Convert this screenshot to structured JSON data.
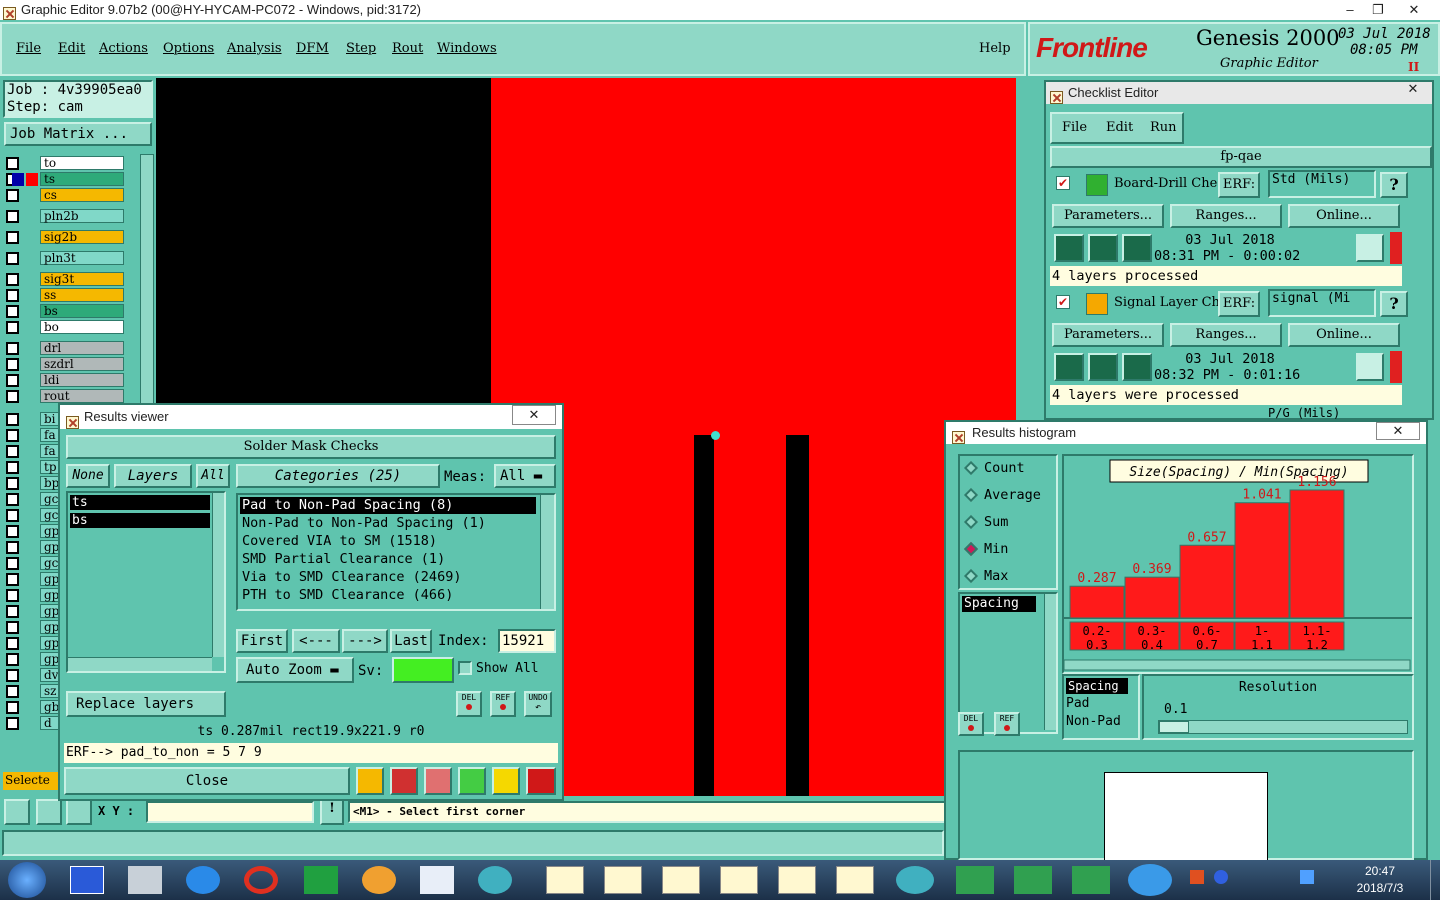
{
  "window": {
    "title": "Graphic Editor 9.07b2 (00@HY-HYCAM-PC072 - Windows, pid:3172)"
  },
  "menu": {
    "items": [
      "File",
      "Edit",
      "Actions",
      "Options",
      "Analysis",
      "DFM",
      "Step",
      "Rout",
      "Windows"
    ],
    "help": "Help"
  },
  "brand": {
    "logo": "Frontline",
    "product": "Genesis 2000",
    "subtitle": "Graphic Editor",
    "date": "03 Jul 2018",
    "time": "08:05 PM",
    "pause": "II"
  },
  "job": {
    "job_line": "Job : 4v39905ea0",
    "step_line": "Step: cam",
    "matrix_button": "Job Matrix ..."
  },
  "layers": [
    {
      "name": "to",
      "color": "#ffffff"
    },
    {
      "name": "ts",
      "color": "#2eaa7a"
    },
    {
      "name": "cs",
      "color": "#f5b800"
    },
    {
      "name": "pln2b",
      "color": "#80d8c8"
    },
    {
      "name": "sig2b",
      "color": "#f5b800"
    },
    {
      "name": "pln3t",
      "color": "#80d8c8"
    },
    {
      "name": "sig3t",
      "color": "#f5b800"
    },
    {
      "name": "ss",
      "color": "#f5b800"
    },
    {
      "name": "bs",
      "color": "#2eaa7a"
    },
    {
      "name": "bo",
      "color": "#ffffff"
    },
    {
      "name": "drl",
      "color": "#b0b8b8"
    },
    {
      "name": "szdrl",
      "color": "#b0b8b8"
    },
    {
      "name": "ldi",
      "color": "#b0b8b8"
    },
    {
      "name": "rout",
      "color": "#b0b8b8"
    }
  ],
  "layers_partial": [
    "bi",
    "fa",
    "fa",
    "tp",
    "bp",
    "gc",
    "gc",
    "gp",
    "gp",
    "gc",
    "gp",
    "gp",
    "gp",
    "gp",
    "gp",
    "gp",
    "dv",
    "sz",
    "gb",
    "d"
  ],
  "selected_label": "Selecte",
  "statusbar": {
    "xy_label": "X Y :",
    "xy_value": "",
    "prompt": "<M1> - Select first corner"
  },
  "results_viewer": {
    "title": "Results viewer",
    "header": "Solder Mask Checks",
    "tabs": {
      "none": "None",
      "layers": "Layers",
      "all": "All"
    },
    "layers": [
      "ts",
      "bs"
    ],
    "categories_label": "Categories (25)",
    "meas_label": "Meas:",
    "meas_value": "All",
    "categories": [
      "Pad to Non-Pad Spacing (8)",
      "Non-Pad to Non-Pad Spacing (1)",
      "Covered VIA to SM (1518)",
      "SMD Partial Clearance (1)",
      "Via to SMD Clearance (2469)",
      "PTH to SMD Clearance (466)"
    ],
    "nav": {
      "first": "First",
      "prev": "<---",
      "next": "--->",
      "last": "Last",
      "index_label": "Index:",
      "index_value": "15921"
    },
    "auto_zoom": "Auto Zoom",
    "sv_label": "Sv:",
    "show_all": "Show All",
    "replace_layers": "Replace layers",
    "del": "DEL",
    "ref": "REF",
    "undo": "UNDO",
    "info": "ts 0.287mil   rect19.9x221.9   r0",
    "erf": "ERF--> pad_to_non = 5 7 9",
    "close": "Close"
  },
  "checklist": {
    "title": "Checklist Editor",
    "menu": [
      "File",
      "Edit",
      "Run"
    ],
    "name": "fp-qae",
    "checks": [
      {
        "name": "Board-Drill Che",
        "erf_label": "ERF:",
        "erf_value": "Std (Mils)",
        "params": "Parameters...",
        "ranges": "Ranges...",
        "online": "Online...",
        "date": "03 Jul 2018",
        "time": "08:31 PM - 0:00:02",
        "status": "4 layers processed"
      },
      {
        "name": "Signal Layer Ch",
        "erf_label": "ERF:",
        "erf_value": "signal (Mi",
        "params": "Parameters...",
        "ranges": "Ranges...",
        "online": "Online...",
        "date": "03 Jul 2018",
        "time": "08:32 PM - 0:01:16",
        "status": "4 layers were processed"
      }
    ],
    "third_check_partial": "P/G (Mils)"
  },
  "histogram": {
    "title": "Results histogram",
    "options": [
      "Count",
      "Average",
      "Sum",
      "Min",
      "Max"
    ],
    "selected": "Min",
    "list": [
      "Spacing"
    ],
    "chart_title": "Size(Spacing) / Min(Spacing)",
    "lower_list": [
      "Spacing",
      "Pad",
      "Non-Pad"
    ],
    "resolution_label": "Resolution",
    "resolution_value": "0.1",
    "del": "DEL",
    "ref": "REF"
  },
  "chart_data": {
    "type": "bar",
    "title": "Size(Spacing) / Min(Spacing)",
    "categories": [
      "0.2-0.3",
      "0.3-0.4",
      "0.6-0.7",
      "1-1.1",
      "1.1-1.2"
    ],
    "values": [
      0.287,
      0.369,
      0.657,
      1.041,
      1.156
    ],
    "value_labels": [
      "0.287",
      "0.369",
      "0.657",
      "1.041",
      "1.156"
    ],
    "color": "#ff1a1a"
  },
  "taskbar": {
    "clock_time": "20:47",
    "clock_date": "2018/7/3"
  },
  "colors": {
    "teal": "#5fc4ae",
    "canvas_red": "#ff0000",
    "canvas_black": "#000000"
  }
}
